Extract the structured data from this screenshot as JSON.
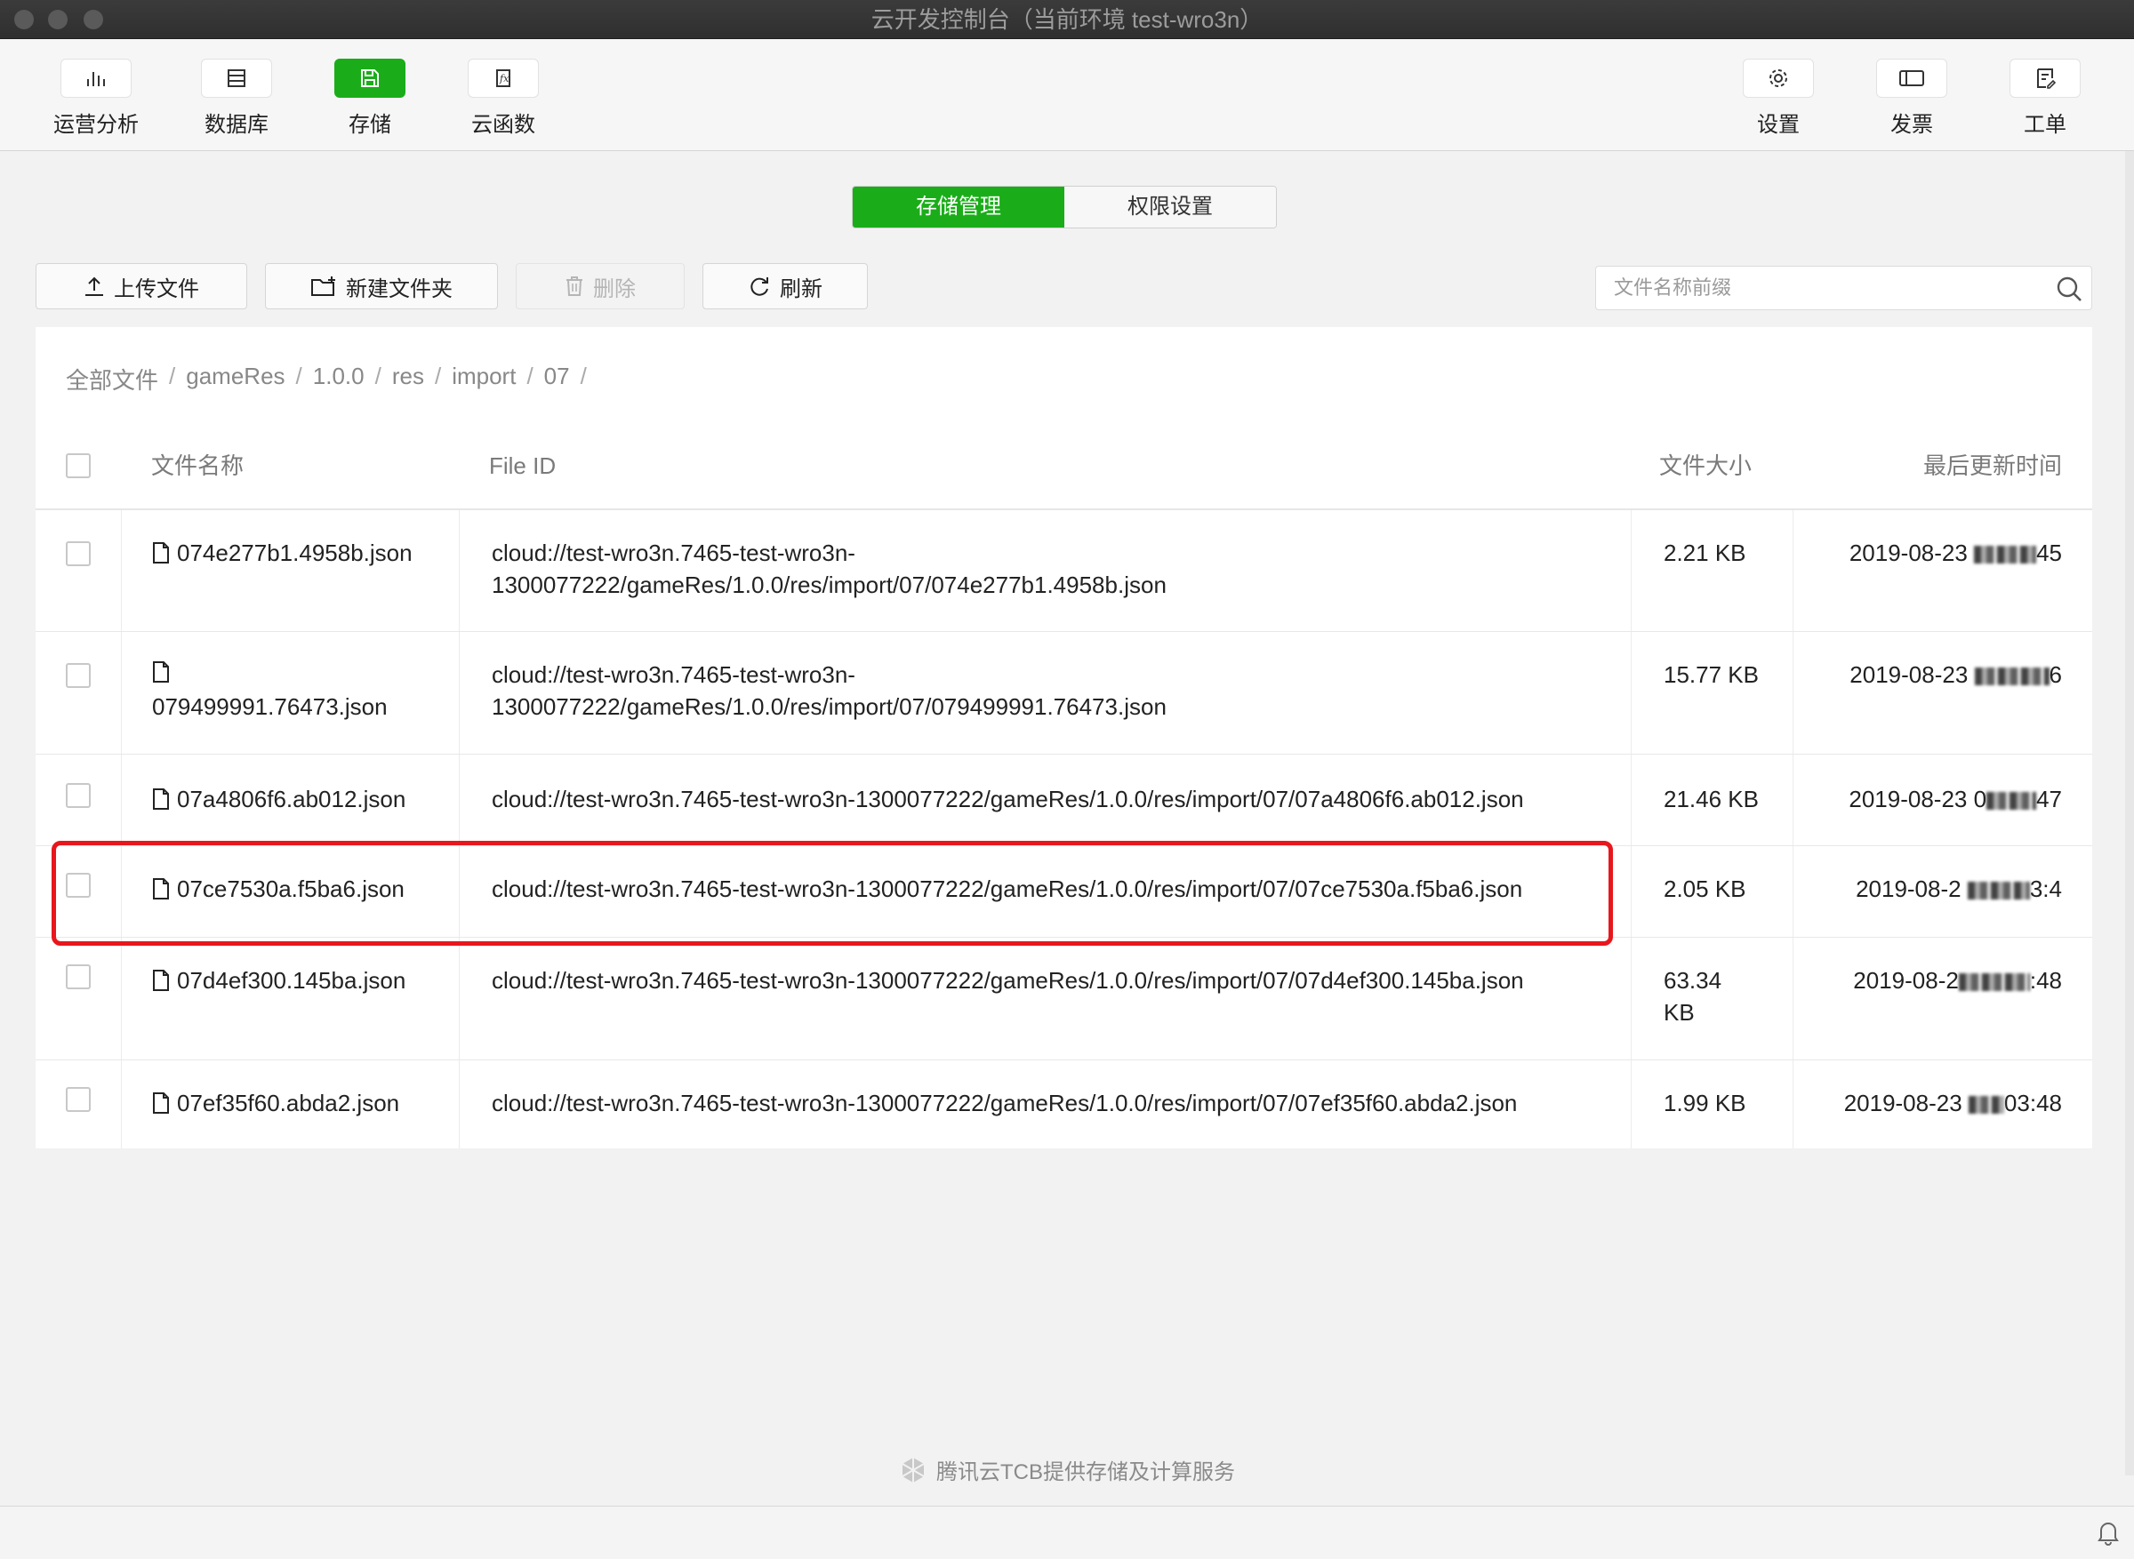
{
  "window": {
    "title": "云开发控制台（当前环境 test-wro3n）"
  },
  "toolbar": {
    "left": [
      {
        "label": "运营分析",
        "icon": "bar-chart-icon"
      },
      {
        "label": "数据库",
        "icon": "database-icon"
      },
      {
        "label": "存储",
        "icon": "storage-icon",
        "active": true
      },
      {
        "label": "云函数",
        "icon": "function-icon"
      }
    ],
    "right": [
      {
        "label": "设置",
        "icon": "gear-icon"
      },
      {
        "label": "发票",
        "icon": "invoice-icon"
      },
      {
        "label": "工单",
        "icon": "ticket-icon"
      }
    ]
  },
  "tabs": {
    "storage": "存储管理",
    "permissions": "权限设置"
  },
  "actions": {
    "upload": "上传文件",
    "new_folder": "新建文件夹",
    "delete": "删除",
    "refresh": "刷新"
  },
  "search": {
    "placeholder": "文件名称前缀"
  },
  "breadcrumb": [
    "全部文件",
    "gameRes",
    "1.0.0",
    "res",
    "import",
    "07"
  ],
  "table": {
    "headers": {
      "name": "文件名称",
      "file_id": "File ID",
      "size": "文件大小",
      "updated": "最后更新时间"
    },
    "rows": [
      {
        "name": "074e277b1.4958b.json",
        "file_id_line1": "cloud://test-wro3n.7465-test-wro3n-",
        "file_id_line2": "1300077222/gameRes/1.0.0/res/import/07/074e277b1.4958b.json",
        "size": "2.21 KB",
        "updated_prefix": "2019-08-23",
        "updated_suffix": "45"
      },
      {
        "name": "079499991.76473.json",
        "file_id_line1": "cloud://test-wro3n.7465-test-wro3n-",
        "file_id_line2": "1300077222/gameRes/1.0.0/res/import/07/079499991.76473.json",
        "size": "15.77 KB",
        "updated_prefix": "2019-08-23",
        "updated_suffix": "6"
      },
      {
        "name": "07a4806f6.ab012.json",
        "file_id_line1": "cloud://test-wro3n.7465-test-wro3n-1300077222/gameRes/1.0.0/res/import/07/07a4806f6.ab012.json",
        "file_id_line2": "",
        "size": "21.46 KB",
        "updated_prefix": "2019-08-23 0",
        "updated_suffix": "47"
      },
      {
        "name": "07ce7530a.f5ba6.json",
        "file_id_line1": "cloud://test-wro3n.7465-test-wro3n-1300077222/gameRes/1.0.0/res/import/07/07ce7530a.f5ba6.json",
        "file_id_line2": "",
        "size": "2.05 KB",
        "updated_prefix": "2019-08-2",
        "updated_suffix": "3:4",
        "highlighted": true
      },
      {
        "name": "07d4ef300.145ba.json",
        "file_id_line1": "cloud://test-wro3n.7465-test-wro3n-1300077222/gameRes/1.0.0/res/import/07/07d4ef300.145ba.json",
        "file_id_line2": "",
        "size": "63.34 KB",
        "updated_prefix": "2019-08-2",
        "updated_suffix": ":48"
      },
      {
        "name": "07ef35f60.abda2.json",
        "file_id_line1": "cloud://test-wro3n.7465-test-wro3n-1300077222/gameRes/1.0.0/res/import/07/07ef35f60.abda2.json",
        "file_id_line2": "",
        "size": "1.99 KB",
        "updated_prefix": "2019-08-23",
        "updated_suffix": "03:48"
      }
    ]
  },
  "footer": {
    "text": "腾讯云TCB提供存储及计算服务"
  },
  "colors": {
    "accent": "#1aad19",
    "highlight": "#e8171d"
  }
}
